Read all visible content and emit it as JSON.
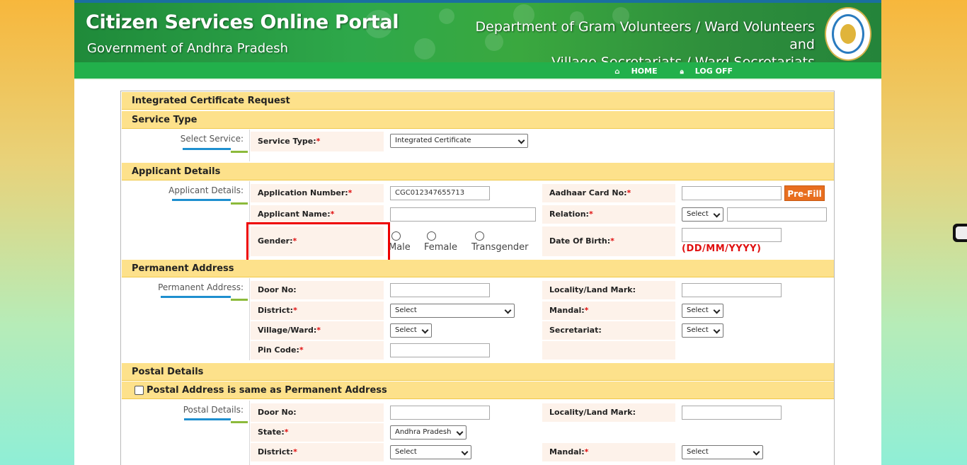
{
  "header": {
    "title": "Citizen Services Online Portal",
    "subtitle": "Government of Andhra Pradesh",
    "dept_line1": "Department of Gram Volunteers / Ward Volunteers and",
    "dept_line2": "Village Secretariats / Ward Secretariats",
    "emblem_icon": "ap-state-emblem"
  },
  "nav": {
    "home": "HOME",
    "logoff": "LOG OFF",
    "home_icon": "home-icon",
    "logoff_icon": "lock-icon"
  },
  "form": {
    "title": "Integrated Certificate Request",
    "service_type": {
      "heading": "Service Type",
      "side_label": "Select Service:",
      "label": "Service Type:",
      "value": "Integrated Certificate"
    },
    "applicant": {
      "heading": "Applicant Details",
      "side_label": "Applicant Details:",
      "application_number_label": "Application Number:",
      "application_number_value": "CGC012347655713",
      "aadhaar_label": "Aadhaar Card No:",
      "aadhaar_value": "",
      "prefill_button": "Pre-Fill",
      "applicant_name_label": "Applicant Name:",
      "applicant_name_value": "",
      "relation_label": "Relation:",
      "relation_select": "Select",
      "relation_value": "",
      "gender_label": "Gender:",
      "gender_options": [
        "Male",
        "Female",
        "Transgender"
      ],
      "dob_label": "Date Of Birth:",
      "dob_value": "",
      "dob_hint": "(DD/MM/YYYY)"
    },
    "permanent": {
      "heading": "Permanent Address",
      "side_label": "Permanent Address:",
      "door_label": "Door No:",
      "locality_label": "Locality/Land Mark:",
      "district_label": "District:",
      "district_value": "Select",
      "mandal_label": "Mandal:",
      "mandal_value": "Select",
      "village_label": "Village/Ward:",
      "village_value": "Select",
      "secretariat_label": "Secretariat:",
      "secretariat_value": "Select",
      "pin_label": "Pin Code:"
    },
    "postal": {
      "heading": "Postal Details",
      "same_as_label": "Postal Address is same as Permanent Address",
      "same_as_checked": false,
      "side_label": "Postal Details:",
      "door_label": "Door No:",
      "locality_label": "Locality/Land Mark:",
      "state_label": "State:",
      "state_value": "Andhra Pradesh",
      "district_label": "District:",
      "district_value": "Select",
      "mandal_label": "Mandal:",
      "mandal_value": "Select"
    },
    "required_mark": "*"
  },
  "colors": {
    "header_green": "#2ea84a",
    "nav_green": "#22b04b",
    "section_yellow": "#fde18b",
    "label_bg": "#fdf2ea",
    "required_red": "#e01010",
    "prefill_orange": "#e86e1f",
    "highlight_red": "#ee0000"
  }
}
